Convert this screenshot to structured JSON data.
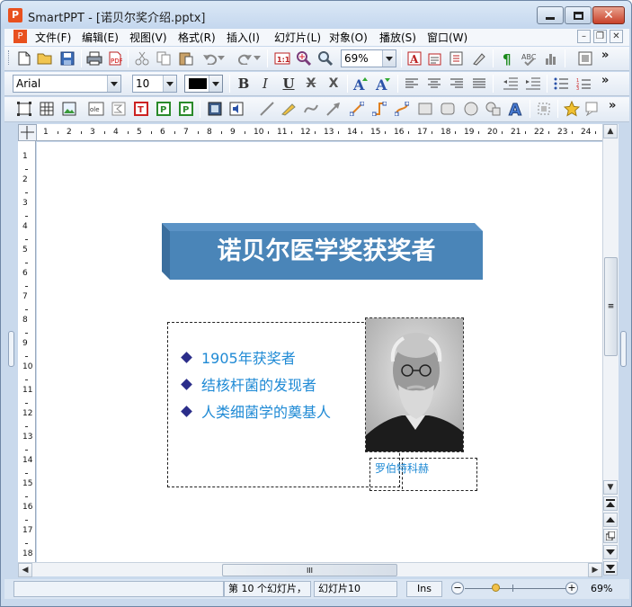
{
  "window": {
    "title": "SmartPPT - [诺贝尔奖介绍.pptx]",
    "app_icon_letter": "P"
  },
  "menu": {
    "items": [
      "文件(F)",
      "编辑(E)",
      "视图(V)",
      "格式(R)",
      "插入(I)",
      "幻灯片(L)",
      "对象(O)",
      "播放(S)",
      "窗口(W)"
    ]
  },
  "toolbar": {
    "zoom_value": "69%",
    "font_name": "Arial",
    "font_size": "10",
    "more_label": "»"
  },
  "rulers": {
    "h_numbers": [
      "1",
      "2",
      "3",
      "4",
      "5",
      "6",
      "7",
      "8",
      "9",
      "10",
      "11",
      "12",
      "13",
      "14",
      "15",
      "16",
      "17",
      "18",
      "19",
      "20",
      "21",
      "22",
      "23",
      "24"
    ],
    "v_numbers": [
      "1",
      "2",
      "3",
      "4",
      "5",
      "6",
      "7",
      "8",
      "9",
      "10",
      "11",
      "12",
      "13",
      "14",
      "15",
      "16",
      "17",
      "18"
    ]
  },
  "slide": {
    "title": "诺贝尔医学奖获奖者",
    "bullets": [
      "1905年获奖者",
      "结核杆菌的发现者",
      "人类细菌学的奠基人"
    ],
    "caption": "罗伯特科赫",
    "colors": {
      "title_face": "#4a85b8",
      "title_top": "#5b93c6",
      "title_side": "#3b6e9d",
      "bullet_text": "#1f8ad5",
      "bullet_marker": "#2b2d8a"
    }
  },
  "scroll": {
    "h_thumb_label": "III",
    "v_thumb_label": "≡"
  },
  "status": {
    "slide_count": "第 10 个幻灯片，",
    "current_slide": "幻灯片10",
    "mode": "Ins",
    "zoom": "69%",
    "zoom_minus": "−",
    "zoom_plus": "+"
  }
}
